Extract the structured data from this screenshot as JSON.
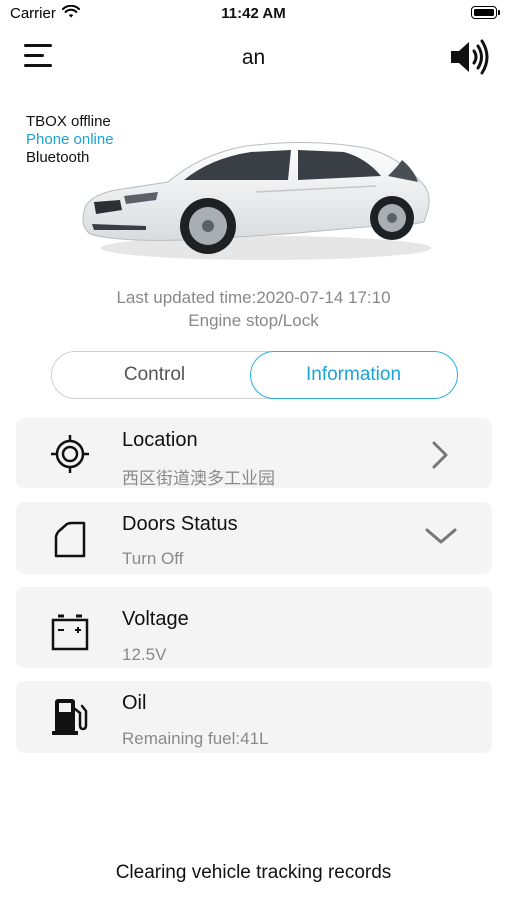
{
  "status_bar": {
    "carrier": "Carrier",
    "time": "11:42 AM"
  },
  "nav": {
    "title": "an",
    "menu_icon": "hamburger-menu-icon",
    "sound_icon": "speaker-icon"
  },
  "connection": {
    "tbox": "TBOX offline",
    "phone": "Phone online",
    "bluetooth": "Bluetooth"
  },
  "vehicle": {
    "last_updated": "Last updated time:2020-07-14 17:10",
    "engine_state": "Engine stop/Lock"
  },
  "tabs": {
    "control": "Control",
    "information": "Information",
    "selected": "Information"
  },
  "cards": [
    {
      "title": "Location",
      "value": "西区街道澳多工业园",
      "icon": "location-target-icon",
      "action": "chevron-right-icon"
    },
    {
      "title": "Doors  Status",
      "value": "Turn Off",
      "icon": "door-icon",
      "action": "chevron-down-icon"
    },
    {
      "title": "Voltage",
      "value": "12.5V",
      "icon": "battery-icon"
    },
    {
      "title": "Oil",
      "value": "Remaining fuel:41L",
      "icon": "fuel-pump-icon"
    }
  ],
  "footer": {
    "clear_label": "Clearing vehicle tracking records"
  },
  "colors": {
    "accent": "#1aa3d8",
    "card_bg": "#f4f4f4",
    "muted_text": "#8a8a8a"
  }
}
